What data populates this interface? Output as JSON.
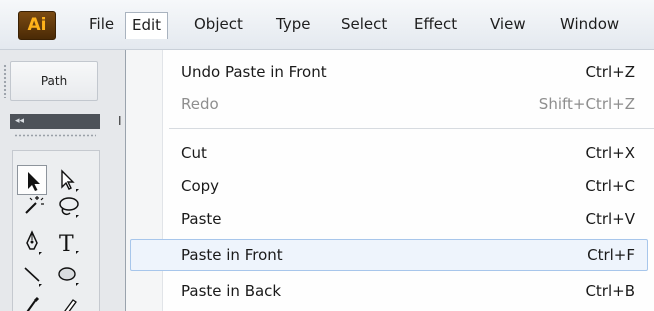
{
  "app": {
    "logo_text": "Ai",
    "logo_color": "#ffb21a"
  },
  "menubar": {
    "items": [
      {
        "label": "File",
        "active": false
      },
      {
        "label": "Edit",
        "active": true
      },
      {
        "label": "Object",
        "active": false
      },
      {
        "label": "Type",
        "active": false
      },
      {
        "label": "Select",
        "active": false
      },
      {
        "label": "Effect",
        "active": false
      },
      {
        "label": "View",
        "active": false
      },
      {
        "label": "Window",
        "active": false
      }
    ]
  },
  "panel": {
    "path_label": "Path",
    "collapse_glyph": "◂◂",
    "strip_glyph": "I"
  },
  "tools": [
    {
      "name": "selection-tool-icon",
      "selected": true
    },
    {
      "name": "direct-selection-tool-icon",
      "selected": false
    },
    {
      "name": "magic-wand-tool-icon",
      "selected": false
    },
    {
      "name": "lasso-tool-icon",
      "selected": false
    },
    {
      "name": "pen-tool-icon",
      "selected": false
    },
    {
      "name": "type-tool-icon",
      "selected": false,
      "glyph": "T"
    },
    {
      "name": "line-segment-tool-icon",
      "selected": false
    },
    {
      "name": "ellipse-tool-icon",
      "selected": false
    },
    {
      "name": "paintbrush-tool-icon",
      "selected": false
    },
    {
      "name": "pencil-tool-icon",
      "selected": false
    }
  ],
  "edit_menu": {
    "items": [
      {
        "label": "Undo Paste in Front",
        "shortcut": "Ctrl+Z",
        "disabled": false,
        "hover": false
      },
      {
        "label": "Redo",
        "shortcut": "Shift+Ctrl+Z",
        "disabled": true,
        "hover": false
      },
      {
        "label": "Cut",
        "shortcut": "Ctrl+X",
        "disabled": false,
        "hover": false
      },
      {
        "label": "Copy",
        "shortcut": "Ctrl+C",
        "disabled": false,
        "hover": false
      },
      {
        "label": "Paste",
        "shortcut": "Ctrl+V",
        "disabled": false,
        "hover": false
      },
      {
        "label": "Paste in Front",
        "shortcut": "Ctrl+F",
        "disabled": false,
        "hover": true
      },
      {
        "label": "Paste in Back",
        "shortcut": "Ctrl+B",
        "disabled": false,
        "hover": false
      }
    ]
  }
}
